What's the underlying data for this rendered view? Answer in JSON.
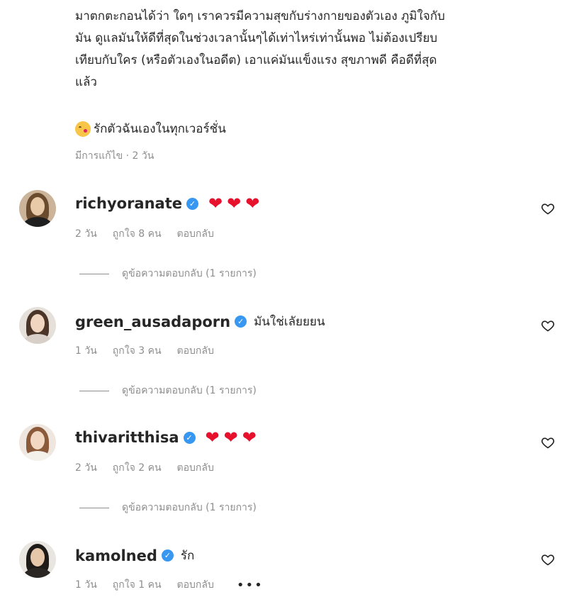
{
  "caption": {
    "text": "มาตกตะกอนได้ว่า ใดๆ เราควรมีความสุขกับร่างกายของตัวเอง ภูมิใจกับ\nมัน ดูแลมันให้ดีที่สุดในช่วงเวลานั้นๆได้เท่าไหร่เท่านั้นพอ ไม่ต้องเปรียบ\nเทียบกับใคร (หรือตัวเองในอดีต) เอาแค่มันแข็งแรง สุขภาพดี คือดีที่สุด\nแล้ว",
    "sign_text": "รักตัวฉันเองในทุกเวอร์ชั่น",
    "meta": "มีการแก้ไข · 2 วัน"
  },
  "like_label": "ถูกใจ",
  "reply_label": "ตอบกลับ",
  "comments": [
    {
      "username": "richyoranate",
      "hearts": [
        "❤",
        "❤",
        "❤"
      ],
      "text": "",
      "time": "2 วัน",
      "likes": "ถูกใจ 8 คน",
      "reply": "ตอบกลับ",
      "view_replies": "ดูข้อความตอบกลับ (1 รายการ)"
    },
    {
      "username": "green_ausadaporn",
      "hearts": [],
      "text": "มันใช่เลัยยยน",
      "time": "1 วัน",
      "likes": "ถูกใจ 3 คน",
      "reply": "ตอบกลับ",
      "view_replies": "ดูข้อความตอบกลับ (1 รายการ)"
    },
    {
      "username": "thivaritthisa",
      "hearts": [
        "❤",
        "❤",
        "❤"
      ],
      "text": "",
      "time": "2 วัน",
      "likes": "ถูกใจ 2 คน",
      "reply": "ตอบกลับ",
      "view_replies": "ดูข้อความตอบกลับ (1 รายการ)"
    },
    {
      "username": "kamolned",
      "hearts": [],
      "text": "รัก",
      "time": "1 วัน",
      "likes": "ถูกใจ 1 คน",
      "reply": "ตอบกลับ",
      "more": "•••"
    }
  ],
  "colors": {
    "text": "#262626",
    "muted": "#8e8e8e",
    "verified": "#3897f0",
    "heart": "#e8112d"
  }
}
